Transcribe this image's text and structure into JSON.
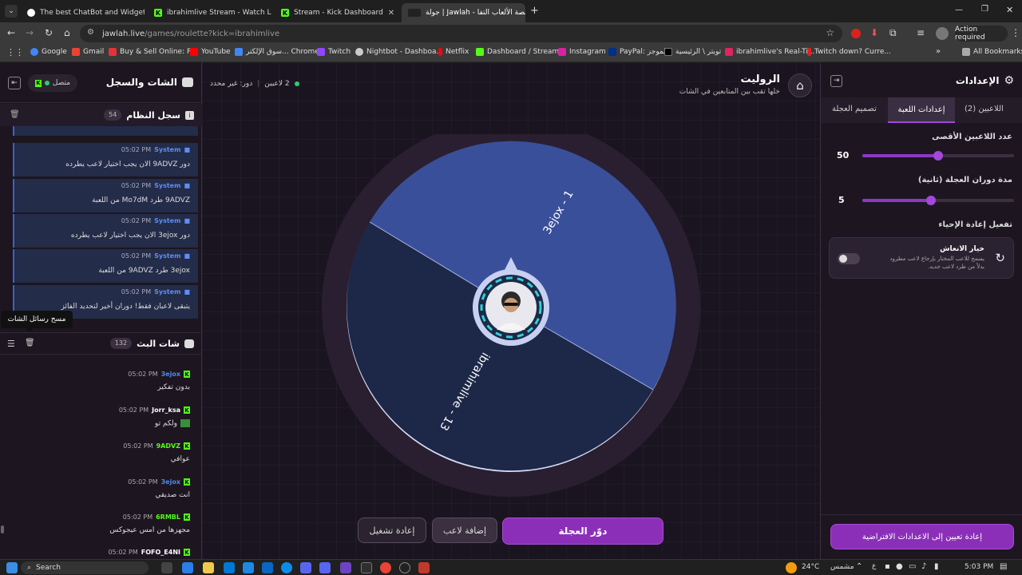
{
  "browser": {
    "tabs": [
      {
        "label": "The best ChatBot and Widgets",
        "icon": "chatbot-favicon"
      },
      {
        "label": "ibrahimlive Stream - Watch Live",
        "icon": "kick-favicon"
      },
      {
        "label": "Stream - Kick Dashboard",
        "icon": "kick-favicon"
      },
      {
        "label": "جولة | Jawlah - منصة الألعاب التفا",
        "icon": "jawlah-favicon"
      }
    ],
    "url_domain": "jawlah.live",
    "url_path": "/games/roulette?kick=ibrahimlive",
    "action_required": "Action required",
    "bookmarks": [
      {
        "label": "Google",
        "color": "#4285f4"
      },
      {
        "label": "Gmail",
        "color": "#ea4335"
      },
      {
        "label": "Buy & Sell Online: P...",
        "color": "#e53238"
      },
      {
        "label": "YouTube",
        "color": "#ff0000"
      },
      {
        "label": "سوق الإلكتر... Chrome",
        "color": "#4285f4"
      },
      {
        "label": "Twitch",
        "color": "#9146ff"
      },
      {
        "label": "Nightbot - Dashboa...",
        "color": "#cccccc"
      },
      {
        "label": "Netflix",
        "color": "#e50914"
      },
      {
        "label": "Dashboard / Stream...",
        "color": "#53fc18"
      },
      {
        "label": "Instagram",
        "color": "#d6249f"
      },
      {
        "label": "PayPal: الموجز",
        "color": "#003087"
      },
      {
        "label": "تويتر \\ الرئيسية",
        "color": "#000000"
      },
      {
        "label": "ibrahimlive's Real-Ti...",
        "color": "#e0245e"
      },
      {
        "label": "Twitch down? Curre...",
        "color": "#e02020"
      }
    ],
    "all_bookmarks": "All Bookmarks"
  },
  "left": {
    "title": "الشات والسجل",
    "status": "متصل",
    "system_log_title": "سجل النظام",
    "system_log_count": "54",
    "system_messages": [
      {
        "time": "05:02 PM",
        "sender": "System",
        "text": "دور 9ADVZ الان يجب اختيار لاعب يطرده"
      },
      {
        "time": "05:02 PM",
        "sender": "System",
        "text": "9ADVZ طرد Mo7dM من اللعبة"
      },
      {
        "time": "05:02 PM",
        "sender": "System",
        "text": "دور 3ejox الان يجب اختيار لاعب يطرده"
      },
      {
        "time": "05:02 PM",
        "sender": "System",
        "text": "3ejox طرد 9ADVZ من اللعبة"
      },
      {
        "time": "05:02 PM",
        "sender": "System",
        "text": "يتبقى لاعبان فقط! دوران أخير لتحديد الفائز"
      }
    ],
    "tooltip": "مسح رسائل الشات",
    "stream_chat_title": "شات البث",
    "stream_chat_count": "132",
    "chat_messages": [
      {
        "time": "05:02 PM",
        "user": "3ejox",
        "color": "#4a8cf0",
        "text": "بدون تفكير"
      },
      {
        "time": "05:02 PM",
        "user": "Jorr_ksa",
        "color": "#ffffff",
        "text": "ولكم تو"
      },
      {
        "time": "05:02 PM",
        "user": "9ADVZ",
        "color": "#53fc18",
        "text": "عوافي"
      },
      {
        "time": "05:02 PM",
        "user": "3ejox",
        "color": "#4a8cf0",
        "text": "انت صديقي"
      },
      {
        "time": "05:02 PM",
        "user": "6RMBL",
        "color": "#53fc18",
        "text": "مجهزها من امس عيجوكس"
      },
      {
        "time": "05:02 PM",
        "user": "FOFO_E4NI",
        "color": "#ffffff",
        "text": ""
      }
    ]
  },
  "center": {
    "title": "الروليت",
    "subtitle": "خلها تقب بين المتابعين في الشات",
    "players_count": "2 لاعبين",
    "turn_status": "دور: غير محدد",
    "segments": [
      {
        "label": "3ejox - 1",
        "color": "#3a4f9a"
      },
      {
        "label": "ibrahimlive - 13",
        "color": "#1d2848"
      }
    ],
    "spin_button": "دوّر العجلة",
    "add_player_button": "إضافة لاعب",
    "restart_button": "إعادة تشغيل"
  },
  "right": {
    "title": "الإعدادات",
    "tabs": [
      "اللاعبين (2)",
      "إعدادات اللعبة",
      "تصميم العجلة"
    ],
    "max_players_label": "عدد اللاعبين الأقصى",
    "max_players_value": "50",
    "max_players_level": 0.5,
    "spin_duration_label": "مدة دوران العجلة (ثانية)",
    "spin_duration_value": "5",
    "spin_duration_level": 0.45,
    "revive_section_label": "تفعيل إعادة الإحياء",
    "revive_option_title": "خيار الانعاش",
    "revive_option_desc_1": "يسمح للاعب المختار بإرجاع لاعب مطرود",
    "revive_option_desc_2": "بدلاً من طرد لاعب جديد.",
    "revive_enabled": false,
    "reset_button": "إعادة تعيين إلى الاعدادات الافتراضية",
    "accent": "#9b3fd0"
  },
  "taskbar": {
    "search": "Search",
    "weather": "24°C",
    "weather_desc": "مشمس",
    "lang": "ع",
    "time": "5:03 PM"
  }
}
